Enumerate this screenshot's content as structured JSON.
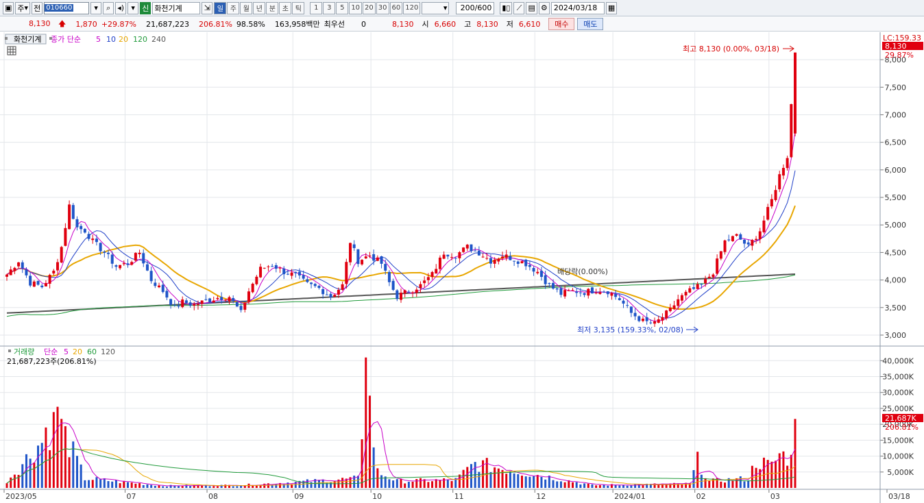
{
  "toolbar": {
    "market": "주",
    "scope": "전",
    "code": "010660",
    "name_flag": "신",
    "name": "화천기계",
    "periods": [
      "일",
      "주",
      "월",
      "년",
      "분",
      "초",
      "틱"
    ],
    "active_period": "일",
    "intervals": [
      "1",
      "3",
      "5",
      "10",
      "20",
      "30",
      "60",
      "120"
    ],
    "count": "200/600",
    "date": "2024/03/18"
  },
  "quote": {
    "price": "8,130",
    "change": "1,870",
    "change_pct": "+29.87%",
    "volume": "21,687,223",
    "volume_pct": "206.81%",
    "ratio": "98.58%",
    "amount": "163,958백만",
    "best_bid_label": "최우선",
    "best_bid_value": "0",
    "best_ask": "8,130",
    "open_label": "시",
    "open": "6,660",
    "high_label": "고",
    "high": "8,130",
    "low_label": "저",
    "low": "6,610",
    "buy": "매수",
    "sell": "매도"
  },
  "price_legend": {
    "name": "화천기계",
    "ma_title": "종가 단순",
    "ma_periods": [
      "5",
      "10",
      "20",
      "120",
      "240"
    ]
  },
  "volume_legend": {
    "title": "거래량",
    "ma_title": "단순",
    "ma_periods": [
      "5",
      "20",
      "60",
      "120"
    ],
    "today": "21,687,223주(206.81%)"
  },
  "annotations": {
    "high": "최고 8,130 (0.00%, 03/18)",
    "low": "최저 3,135 (159.33%, 02/08)",
    "dividend": "배당락(0.00%)",
    "axis_top": "LC:159.33",
    "last_price": "8,130",
    "last_pct": "29.87%",
    "last_volume": "21,687K",
    "last_volume_pct": "206.81%"
  },
  "colors": {
    "up": "#e0000f",
    "down": "#1f55c8",
    "ma5": "#c800c8",
    "ma10": "#1f3fc8",
    "ma20": "#e8a600",
    "ma120": "#1f9a3a",
    "ma240": "#555555"
  },
  "chart_data": {
    "type": "candlestick",
    "price_ticks": [
      "8,000",
      "7,500",
      "7,000",
      "6,500",
      "6,000",
      "5,500",
      "5,000",
      "4,500",
      "4,000",
      "3,500",
      "3,000"
    ],
    "price_tick_values": [
      8000,
      7500,
      7000,
      6500,
      6000,
      5500,
      5000,
      4500,
      4000,
      3500,
      3000
    ],
    "volume_ticks": [
      "40,000K",
      "35,000K",
      "30,000K",
      "25,000K",
      "20,000K",
      "15,000K",
      "10,000K",
      "5,000K"
    ],
    "volume_tick_values": [
      40000,
      35000,
      30000,
      25000,
      20000,
      15000,
      10000,
      5000
    ],
    "x_labels": [
      "2023/05",
      "07",
      "08",
      "09",
      "10",
      "11",
      "12",
      "2024/01",
      "02",
      "03",
      "03/18"
    ],
    "x_label_index": [
      0,
      31,
      52,
      74,
      94,
      115,
      136,
      156,
      177,
      196,
      209
    ],
    "ylim": [
      2900,
      8250
    ],
    "vol_ylim": [
      0,
      42000
    ],
    "ma_periods": [
      5,
      10,
      20,
      120,
      240
    ],
    "anchors": [
      [
        0,
        4100
      ],
      [
        3,
        4350
      ],
      [
        6,
        3950
      ],
      [
        9,
        3880
      ],
      [
        12,
        4150
      ],
      [
        14,
        4600
      ],
      [
        16,
        5350
      ],
      [
        18,
        4950
      ],
      [
        20,
        4900
      ],
      [
        22,
        4700
      ],
      [
        25,
        4500
      ],
      [
        28,
        4250
      ],
      [
        31,
        4300
      ],
      [
        34,
        4500
      ],
      [
        37,
        4000
      ],
      [
        40,
        3800
      ],
      [
        43,
        3500
      ],
      [
        45,
        3600
      ],
      [
        48,
        3550
      ],
      [
        51,
        3620
      ],
      [
        54,
        3680
      ],
      [
        57,
        3700
      ],
      [
        60,
        3400
      ],
      [
        62,
        3800
      ],
      [
        65,
        4200
      ],
      [
        68,
        4280
      ],
      [
        71,
        4150
      ],
      [
        74,
        4080
      ],
      [
        77,
        3920
      ],
      [
        80,
        3850
      ],
      [
        83,
        3700
      ],
      [
        86,
        3900
      ],
      [
        88,
        4700
      ],
      [
        90,
        4350
      ],
      [
        93,
        4450
      ],
      [
        96,
        4300
      ],
      [
        98,
        3950
      ],
      [
        100,
        3700
      ],
      [
        103,
        3800
      ],
      [
        106,
        3900
      ],
      [
        109,
        4100
      ],
      [
        112,
        4500
      ],
      [
        115,
        4450
      ],
      [
        118,
        4600
      ],
      [
        121,
        4500
      ],
      [
        124,
        4350
      ],
      [
        127,
        4450
      ],
      [
        130,
        4380
      ],
      [
        133,
        4300
      ],
      [
        136,
        4150
      ],
      [
        139,
        3900
      ],
      [
        142,
        3750
      ],
      [
        145,
        3800
      ],
      [
        148,
        3780
      ],
      [
        151,
        3820
      ],
      [
        154,
        3800
      ],
      [
        157,
        3650
      ],
      [
        160,
        3400
      ],
      [
        163,
        3250
      ],
      [
        166,
        3200
      ],
      [
        168,
        3330
      ],
      [
        170,
        3450
      ],
      [
        172,
        3650
      ],
      [
        175,
        3800
      ],
      [
        178,
        3900
      ],
      [
        181,
        4150
      ],
      [
        184,
        4700
      ],
      [
        187,
        4800
      ],
      [
        190,
        4600
      ],
      [
        193,
        4900
      ],
      [
        196,
        5450
      ],
      [
        198,
        5900
      ],
      [
        200,
        6250
      ],
      [
        202,
        8130
      ]
    ],
    "volume_anchors": [
      [
        0,
        2500
      ],
      [
        10,
        19000
      ],
      [
        13,
        25500
      ],
      [
        20,
        3500
      ],
      [
        40,
        800
      ],
      [
        60,
        1000
      ],
      [
        90,
        3500
      ],
      [
        92,
        41000
      ],
      [
        93,
        29000
      ],
      [
        95,
        6000
      ],
      [
        100,
        2500
      ],
      [
        115,
        3000
      ],
      [
        120,
        9000
      ],
      [
        130,
        6500
      ],
      [
        150,
        1000
      ],
      [
        175,
        1500
      ],
      [
        177,
        10000
      ],
      [
        180,
        2500
      ],
      [
        190,
        3500
      ],
      [
        192,
        10000
      ],
      [
        196,
        8000
      ],
      [
        198,
        12500
      ],
      [
        200,
        11500
      ],
      [
        201,
        10500
      ],
      [
        202,
        21687
      ]
    ]
  }
}
